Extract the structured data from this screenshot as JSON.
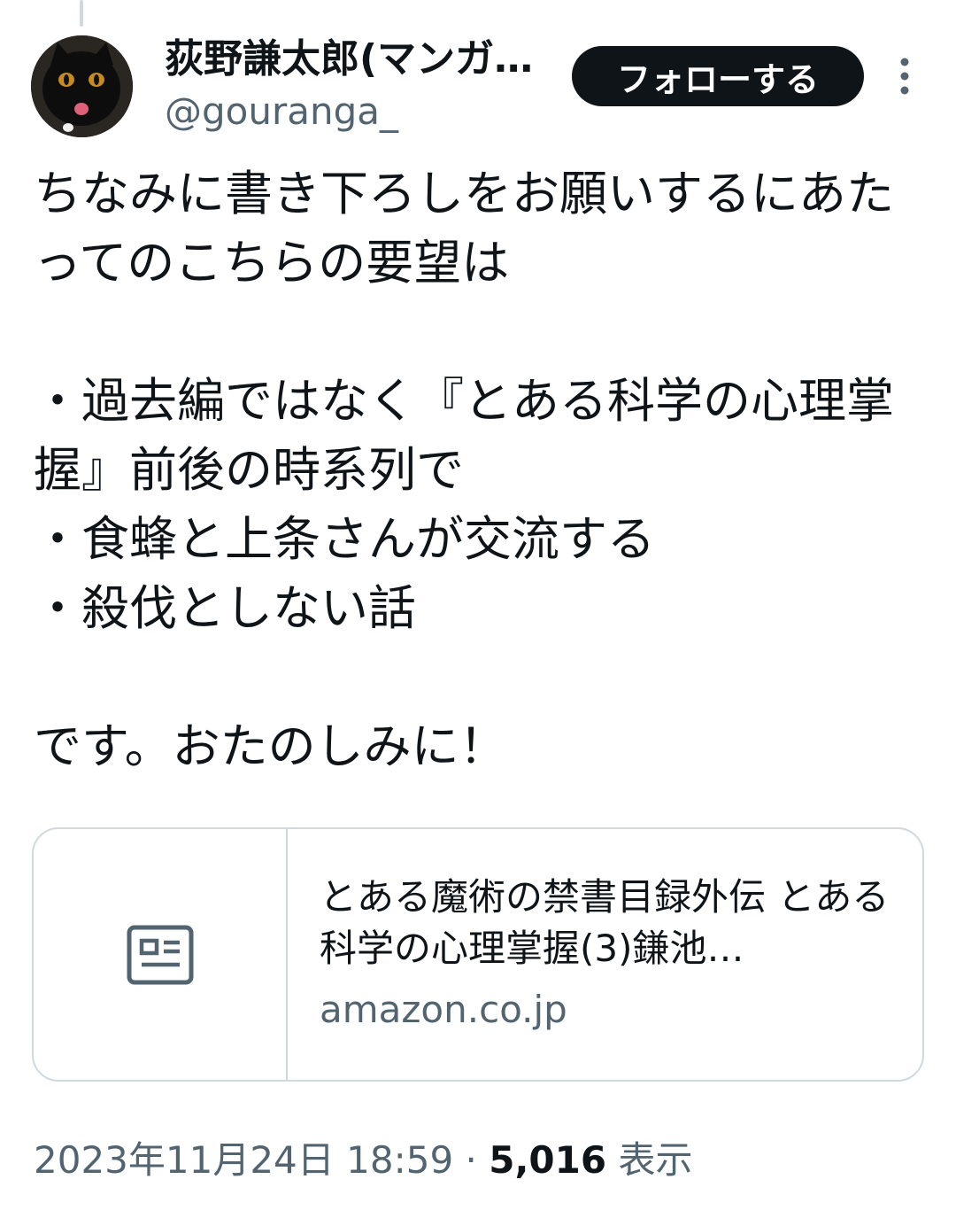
{
  "author": {
    "display_name": "荻野謙太郎(マンガ原作者)",
    "handle": "@gouranga_"
  },
  "follow_button": {
    "label": "フォローする"
  },
  "tweet": {
    "text": "ちなみに書き下ろしをお願いするにあたってのこちらの要望は\n\n・過去編ではなく『とある科学の心理掌握』前後の時系列で\n・食蜂と上条さんが交流する\n・殺伐としない話\n\nです。おたのしみに！"
  },
  "link_card": {
    "title": "とある魔術の禁書目録外伝 とある科学の心理掌握(3)鎌池…",
    "domain": "amazon.co.jp",
    "icon": "article-icon"
  },
  "meta": {
    "timestamp": "2023年11月24日 18:59",
    "separator": "·",
    "views_count": "5,016",
    "views_label": "表示"
  },
  "colors": {
    "text_primary": "#0f1419",
    "text_secondary": "#536471",
    "border": "#cfd9de",
    "button_bg": "#0f1419"
  }
}
